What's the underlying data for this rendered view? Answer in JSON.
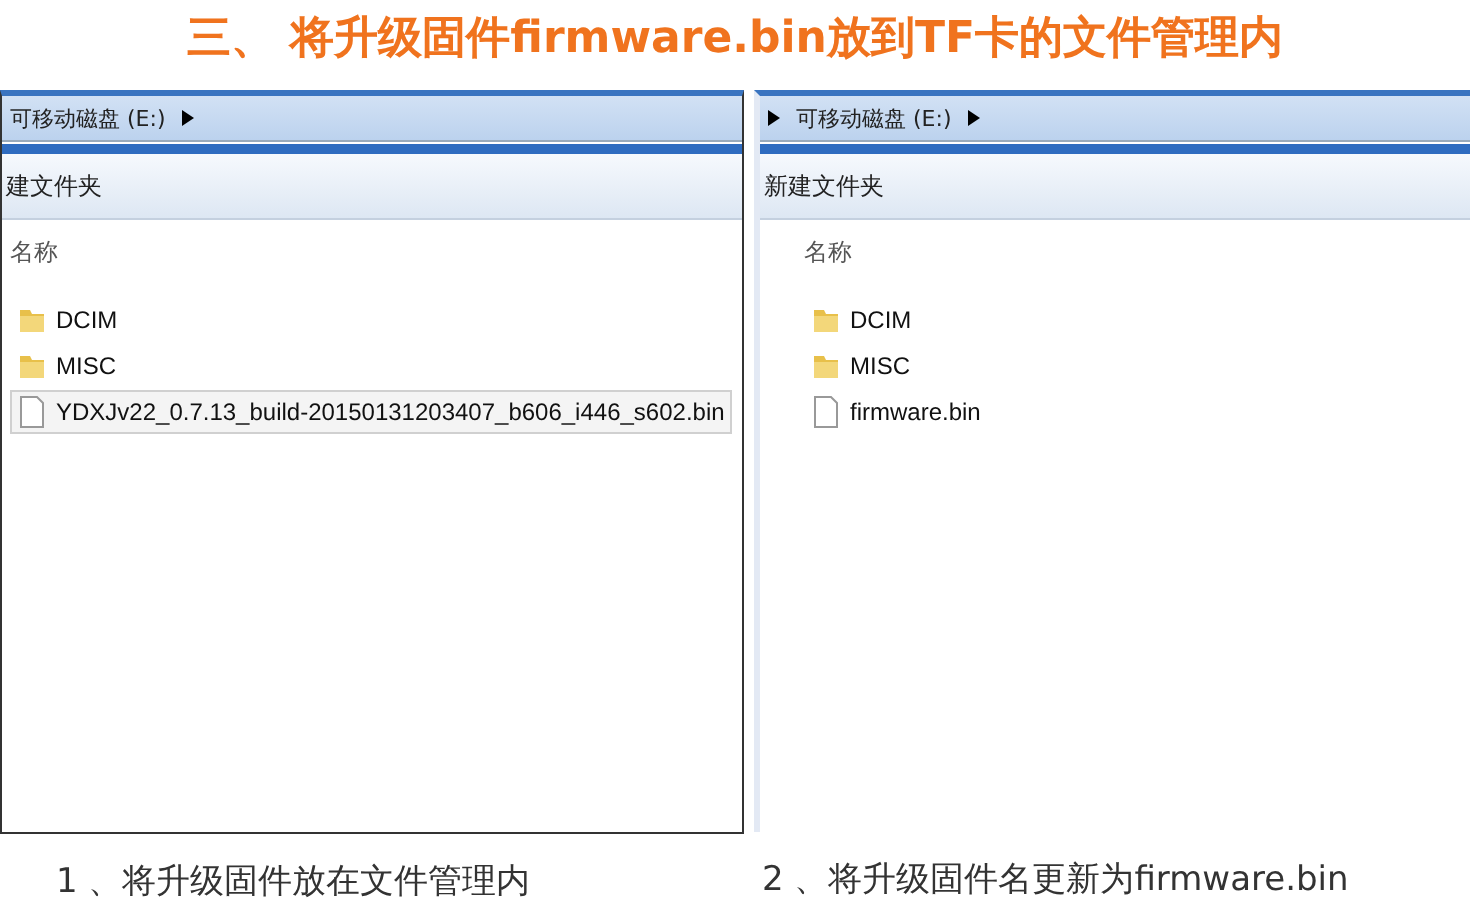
{
  "title": "三、 将升级固件firmware.bin放到TF卡的文件管理内",
  "panels": [
    {
      "lead_arrow": false,
      "breadcrumb": "可移动磁盘 (E:)",
      "toolbar_button": "建文件夹",
      "column_header": "名称",
      "items": [
        {
          "kind": "folder",
          "name": "DCIM",
          "selected": false
        },
        {
          "kind": "folder",
          "name": "MISC",
          "selected": false
        },
        {
          "kind": "file",
          "name": "YDXJv22_0.7.13_build-20150131203407_b606_i446_s602.bin",
          "selected": true
        }
      ],
      "caption": "1 、将升级固件放在文件管理内"
    },
    {
      "lead_arrow": true,
      "breadcrumb": "可移动磁盘 (E:)",
      "toolbar_button": "新建文件夹",
      "column_header": "名称",
      "items": [
        {
          "kind": "folder",
          "name": "DCIM",
          "selected": false
        },
        {
          "kind": "folder",
          "name": "MISC",
          "selected": false
        },
        {
          "kind": "file",
          "name": "firmware.bin",
          "selected": false
        }
      ],
      "caption": "2 、将升级固件名更新为firmware.bin"
    }
  ]
}
